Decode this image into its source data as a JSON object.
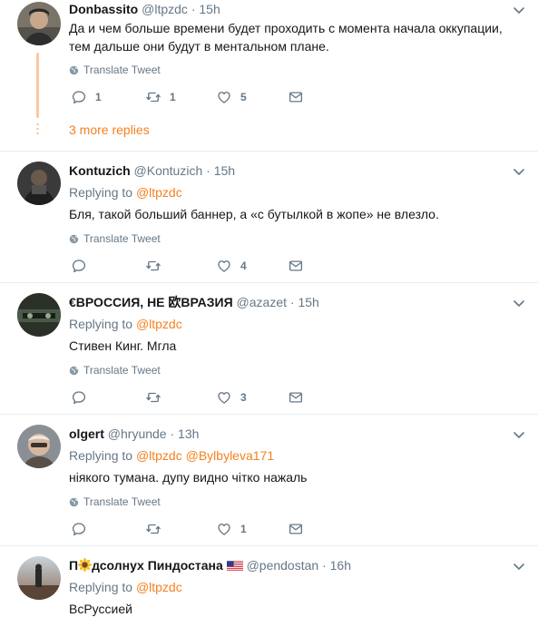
{
  "colors": {
    "link": "#f5801f",
    "muted": "#657786",
    "text": "#14171a",
    "divider": "#e6ecf0"
  },
  "translate_label": "Translate Tweet",
  "more_replies": "3 more replies",
  "tweets": [
    {
      "name": "Donbassito",
      "handle": "@ltpzdc",
      "dot": "·",
      "time": "15h",
      "text_lines": [
        "Да и чем больше времени будет проходить с момента начала оккупации,",
        "тем дальше они будут в ментальном плане."
      ],
      "replies": "1",
      "retweets": "1",
      "likes": "5"
    },
    {
      "name": "Kontuzich",
      "handle": "@Kontuzich",
      "dot": "·",
      "time": "15h",
      "replying_label": "Replying to",
      "replying_to": "@ltpzdc",
      "text": "Бля, такой больший баннер, а «с бутылкой в жопе» не влезло.",
      "replies": "",
      "retweets": "",
      "likes": "4"
    },
    {
      "name": "€ВРОССИЯ, НЕ 欧ВРАЗИЯ",
      "handle": "@azazet",
      "dot": "·",
      "time": "15h",
      "replying_label": "Replying to",
      "replying_to": "@ltpzdc",
      "text": "Стивен Кинг. Мгла",
      "replies": "",
      "retweets": "",
      "likes": "3"
    },
    {
      "name": "olgert",
      "handle": "@hryunde",
      "dot": "·",
      "time": "13h",
      "replying_label": "Replying to",
      "replying_to": "@ltpzdc",
      "replying_to_2": "@Bylbyleva171",
      "text": "ніякого тумана. дупу видно чітко нажаль",
      "replies": "",
      "retweets": "",
      "likes": "1"
    },
    {
      "name_prefix": "П",
      "name_suffix": "дсолнух Пиндостана",
      "sunflower_icon": "sunflower-emoji",
      "flag_icon": "us-flag-emoji",
      "handle": "@pendostan",
      "dot": "·",
      "time": "16h",
      "replying_label": "Replying to",
      "replying_to": "@ltpzdc",
      "text": "ВсРуссией"
    }
  ]
}
